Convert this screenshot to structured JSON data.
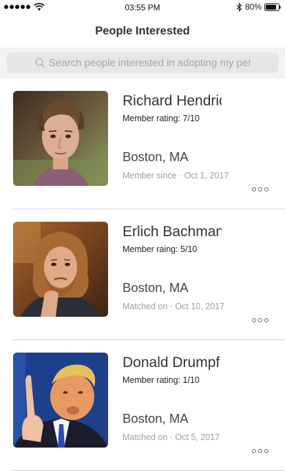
{
  "status_bar": {
    "time": "03:55 PM",
    "battery": "80%",
    "icons": [
      "signal-dots",
      "wifi-icon",
      "bluetooth-icon",
      "battery-icon"
    ]
  },
  "header": {
    "title": "People Interested"
  },
  "search": {
    "placeholder": "Search people interested in adopting my pet",
    "icon": "search-icon"
  },
  "people": [
    {
      "name": "Richard Hendrick",
      "rating": "Member rating: 7/10",
      "location": "Boston, MA",
      "meta": "Member since · Oct 1, 2017"
    },
    {
      "name": "Erlich Bachman",
      "rating": "Member raing: 5/10",
      "location": "Boston, MA",
      "meta": "Matched on · Oct 10, 2017"
    },
    {
      "name": "Donald Drumpf",
      "rating": "Member rating: 1/10",
      "location": "Boston, MA",
      "meta": "Matched on · Oct 5, 2017"
    }
  ],
  "colors": {
    "divider": "#d2d2d2",
    "search_bg": "#f3f3f3",
    "search_box": "#e6e6e6",
    "meta_text": "#a0a0a0"
  }
}
